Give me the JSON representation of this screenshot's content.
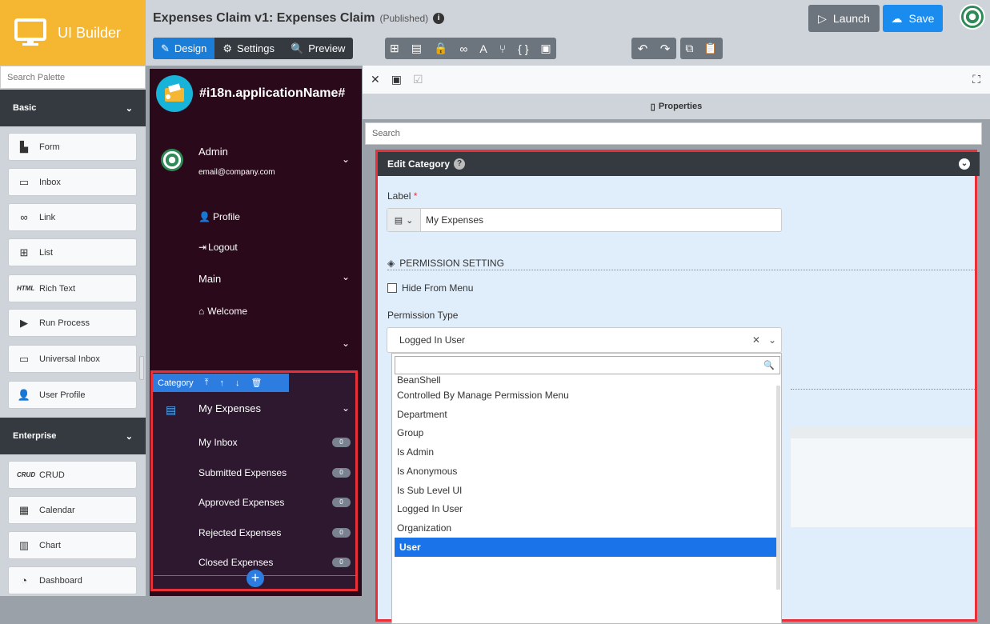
{
  "app": {
    "logo_label": "UI Builder",
    "title": "Expenses Claim v1: Expenses Claim",
    "status": "(Published)",
    "launch": "Launch",
    "save": "Save"
  },
  "tabs": [
    {
      "label": "Design",
      "icon": "design-icon"
    },
    {
      "label": "Settings",
      "icon": "gear-icon"
    },
    {
      "label": "Preview",
      "icon": "preview-icon"
    }
  ],
  "palette": {
    "search_placeholder": "Search Palette",
    "sections": [
      {
        "title": "Basic",
        "items": [
          {
            "label": "Form",
            "icon": "form-icon"
          },
          {
            "label": "Inbox",
            "icon": "inbox-icon"
          },
          {
            "label": "Link",
            "icon": "link-icon"
          },
          {
            "label": "List",
            "icon": "list-icon"
          },
          {
            "label": "Rich Text",
            "icon": "html-icon",
            "icon_text": "HTML"
          },
          {
            "label": "Run Process",
            "icon": "play-icon"
          },
          {
            "label": "Universal Inbox",
            "icon": "inbox-icon"
          },
          {
            "label": "User Profile",
            "icon": "user-icon"
          }
        ]
      },
      {
        "title": "Enterprise",
        "items": [
          {
            "label": "CRUD",
            "icon": "crud-icon",
            "icon_text": "CRUD"
          },
          {
            "label": "Calendar",
            "icon": "calendar-icon"
          },
          {
            "label": "Chart",
            "icon": "chart-icon"
          },
          {
            "label": "Dashboard",
            "icon": "dashboard-icon"
          }
        ]
      }
    ]
  },
  "preview": {
    "brand": "#i18n.applicationName#",
    "user_name": "Admin",
    "user_email": "email@company.com",
    "profile": "Profile",
    "logout": "Logout",
    "main": "Main",
    "welcome": "Welcome",
    "category_label": "Category",
    "category_title": "My Expenses",
    "sub_items": [
      {
        "label": "My Inbox",
        "count": "0"
      },
      {
        "label": "Submitted Expenses",
        "count": "0"
      },
      {
        "label": "Approved Expenses",
        "count": "0"
      },
      {
        "label": "Rejected Expenses",
        "count": "0"
      },
      {
        "label": "Closed Expenses",
        "count": "0"
      }
    ]
  },
  "properties": {
    "title": "Properties",
    "search_placeholder": "Search",
    "edit_title": "Edit Category",
    "label_field": "Label",
    "required_mark": "*",
    "label_value": "My Expenses",
    "permission_heading": "PERMISSION SETTING",
    "hide_from_menu": "Hide From Menu",
    "permission_type_label": "Permission Type",
    "permission_type_value": "Logged In User",
    "options": [
      "BeanShell",
      "Controlled By Manage Permission Menu",
      "Department",
      "Group",
      "Is Admin",
      "Is Anonymous",
      "Is Sub Level UI",
      "Logged In User",
      "Organization",
      "User"
    ],
    "selected_option": "User"
  },
  "colors": {
    "accent": "#1a7ed8",
    "logo_bg": "#f5b731",
    "highlight_frame": "#e8303a",
    "preview_bg": "#2a0a1a"
  }
}
